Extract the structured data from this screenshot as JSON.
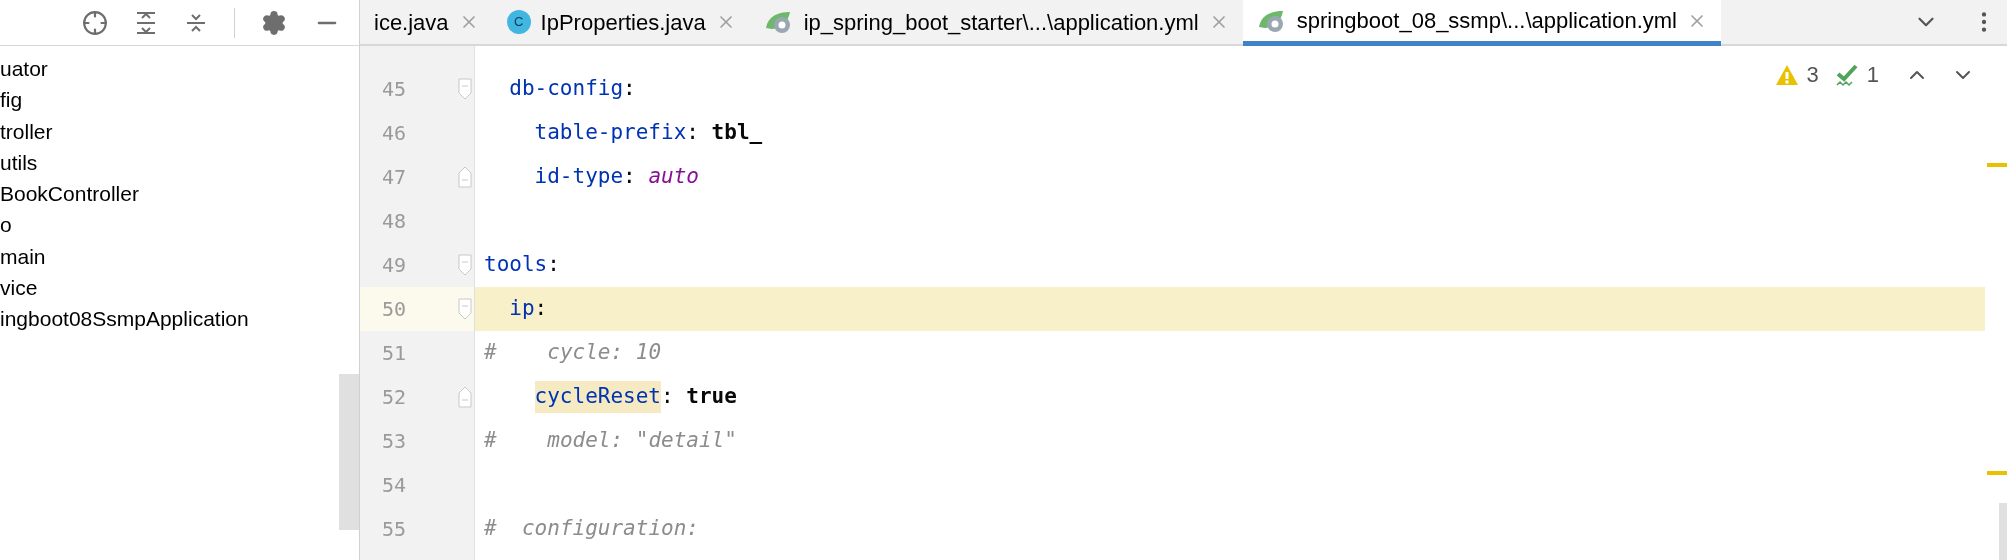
{
  "project_tree": {
    "items": [
      {
        "label": "uator"
      },
      {
        "label": "fig"
      },
      {
        "label": "troller"
      },
      {
        "label": "utils"
      },
      {
        "label": "BookController"
      },
      {
        "label": "o"
      },
      {
        "label": "main"
      },
      {
        "label": "vice"
      },
      {
        "label": "ingboot08SsmpApplication"
      }
    ]
  },
  "tabs": [
    {
      "label": "ice.java",
      "kind": "plain",
      "selected": false
    },
    {
      "label": "IpProperties.java",
      "kind": "class",
      "class_letter": "C",
      "selected": false
    },
    {
      "label": "ip_spring_boot_starter\\...\\application.yml",
      "kind": "spring",
      "selected": false
    },
    {
      "label": "springboot_08_ssmp\\...\\application.yml",
      "kind": "spring",
      "selected": true
    }
  ],
  "inspections": {
    "warnings": "3",
    "weak_warnings": "1"
  },
  "editor": {
    "lines": [
      {
        "number": "45",
        "current": false,
        "kind": "opener",
        "tokens": [
          {
            "text": "  db-config",
            "kind": "key"
          },
          {
            "text": ":",
            "kind": "punct"
          }
        ]
      },
      {
        "number": "46",
        "current": false,
        "kind": "plain",
        "tokens": [
          {
            "text": "    table-prefix",
            "kind": "key"
          },
          {
            "text": ": ",
            "kind": "punct"
          },
          {
            "text": "tbl_",
            "kind": "value"
          }
        ]
      },
      {
        "number": "47",
        "current": false,
        "kind": "closer",
        "tokens": [
          {
            "text": "    id-type",
            "kind": "key"
          },
          {
            "text": ": ",
            "kind": "punct"
          },
          {
            "text": "auto",
            "kind": "constant"
          }
        ]
      },
      {
        "number": "48",
        "current": false,
        "kind": "plain"
      },
      {
        "number": "49",
        "current": false,
        "kind": "opener",
        "tokens": [
          {
            "text": "tools",
            "kind": "key"
          },
          {
            "text": ":",
            "kind": "punct"
          }
        ]
      },
      {
        "number": "50",
        "current": true,
        "kind": "opener",
        "tokens": [
          {
            "text": "  ip",
            "kind": "key"
          },
          {
            "text": ":",
            "kind": "punct"
          }
        ]
      },
      {
        "number": "51",
        "current": false,
        "kind": "plain",
        "tokens": [
          {
            "text": "#",
            "kind": "comment"
          },
          {
            "text": "    cycle: 10",
            "kind": "comment"
          }
        ]
      },
      {
        "number": "52",
        "current": false,
        "kind": "closer",
        "tokens": [
          {
            "text": "    cycleReset",
            "kind": "key",
            "highlighted": true
          },
          {
            "text": ": ",
            "kind": "punct"
          },
          {
            "text": "true",
            "kind": "value"
          }
        ]
      },
      {
        "number": "53",
        "current": false,
        "kind": "plain",
        "tokens": [
          {
            "text": "#",
            "kind": "comment"
          },
          {
            "text": "    model: \"detail\"",
            "kind": "comment"
          }
        ]
      },
      {
        "number": "54",
        "current": false,
        "kind": "plain"
      },
      {
        "number": "55",
        "current": false,
        "kind": "plain",
        "tokens": [
          {
            "text": "#",
            "kind": "comment"
          },
          {
            "text": "  configuration:",
            "kind": "comment"
          }
        ]
      }
    ]
  }
}
